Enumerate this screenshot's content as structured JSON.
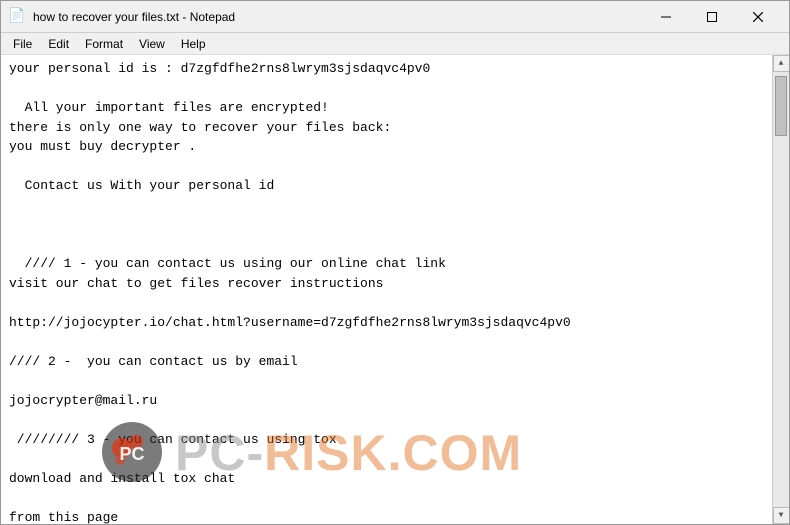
{
  "window": {
    "title": "how to recover your files.txt - Notepad",
    "icon": "📄"
  },
  "titlebar": {
    "minimize_label": "─",
    "maximize_label": "□",
    "close_label": "✕"
  },
  "menubar": {
    "items": [
      "File",
      "Edit",
      "Format",
      "View",
      "Help"
    ]
  },
  "content": {
    "text": "your personal id is : d7zgfdfhe2rns8lwrym3sjsdaqvc4pv0\n\n  All your important files are encrypted!\nthere is only one way to recover your files back:\nyou must buy decrypter .\n\n  Contact us With your personal id\n\n\n\n  //// 1 - you can contact us using our online chat link\nvisit our chat to get files recover instructions\n\nhttp://jojocypter.io/chat.html?username=d7zgfdfhe2rns8lwrym3sjsdaqvc4pv0\n\n//// 2 -  you can contact us by email\n\njojocrypter@mail.ru\n\n //////// 3 - you can contact us using tox\n\ndownload and install tox chat\n\nfrom this page\n\nhttps://tox.chat/\n\nand add us"
  },
  "watermark": {
    "text_part1": "PC",
    "text_separator": "-",
    "text_part2": "RISK.COM"
  }
}
